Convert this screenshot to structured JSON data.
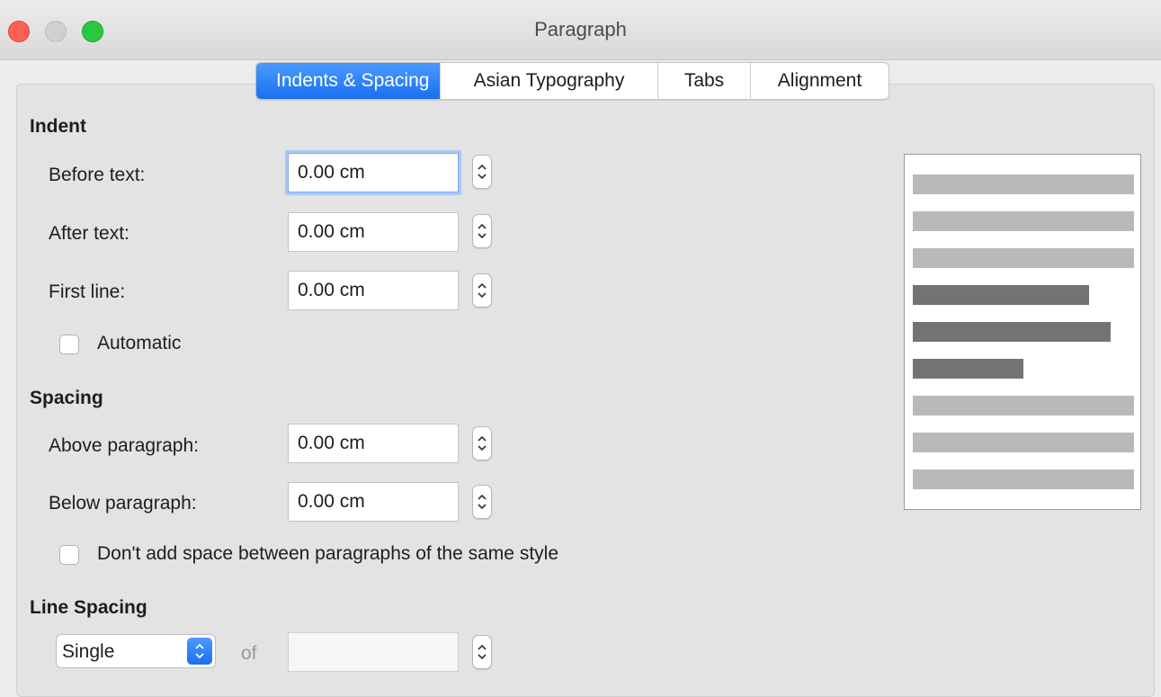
{
  "window": {
    "title": "Paragraph"
  },
  "tabs": [
    {
      "label": "Indents & Spacing",
      "active": true
    },
    {
      "label": "Asian Typography",
      "active": false
    },
    {
      "label": "Tabs",
      "active": false
    },
    {
      "label": "Alignment",
      "active": false
    }
  ],
  "indent": {
    "heading": "Indent",
    "before_text": {
      "label": "Before text:",
      "value": "0.00 cm"
    },
    "after_text": {
      "label": "After text:",
      "value": "0.00 cm"
    },
    "first_line": {
      "label": "First line:",
      "value": "0.00 cm"
    },
    "automatic": {
      "label": "Automatic",
      "checked": false
    }
  },
  "spacing": {
    "heading": "Spacing",
    "above_paragraph": {
      "label": "Above paragraph:",
      "value": "0.00 cm"
    },
    "below_paragraph": {
      "label": "Below paragraph:",
      "value": "0.00 cm"
    },
    "dont_add_space": {
      "label": "Don't add space between paragraphs of the same style",
      "checked": false
    }
  },
  "line_spacing": {
    "heading": "Line Spacing",
    "selected": "Single",
    "of_label": "of",
    "value": ""
  },
  "colors": {
    "accent": "#1a6ff0",
    "preview_light": "#b9b9b9",
    "preview_dark": "#737373"
  }
}
